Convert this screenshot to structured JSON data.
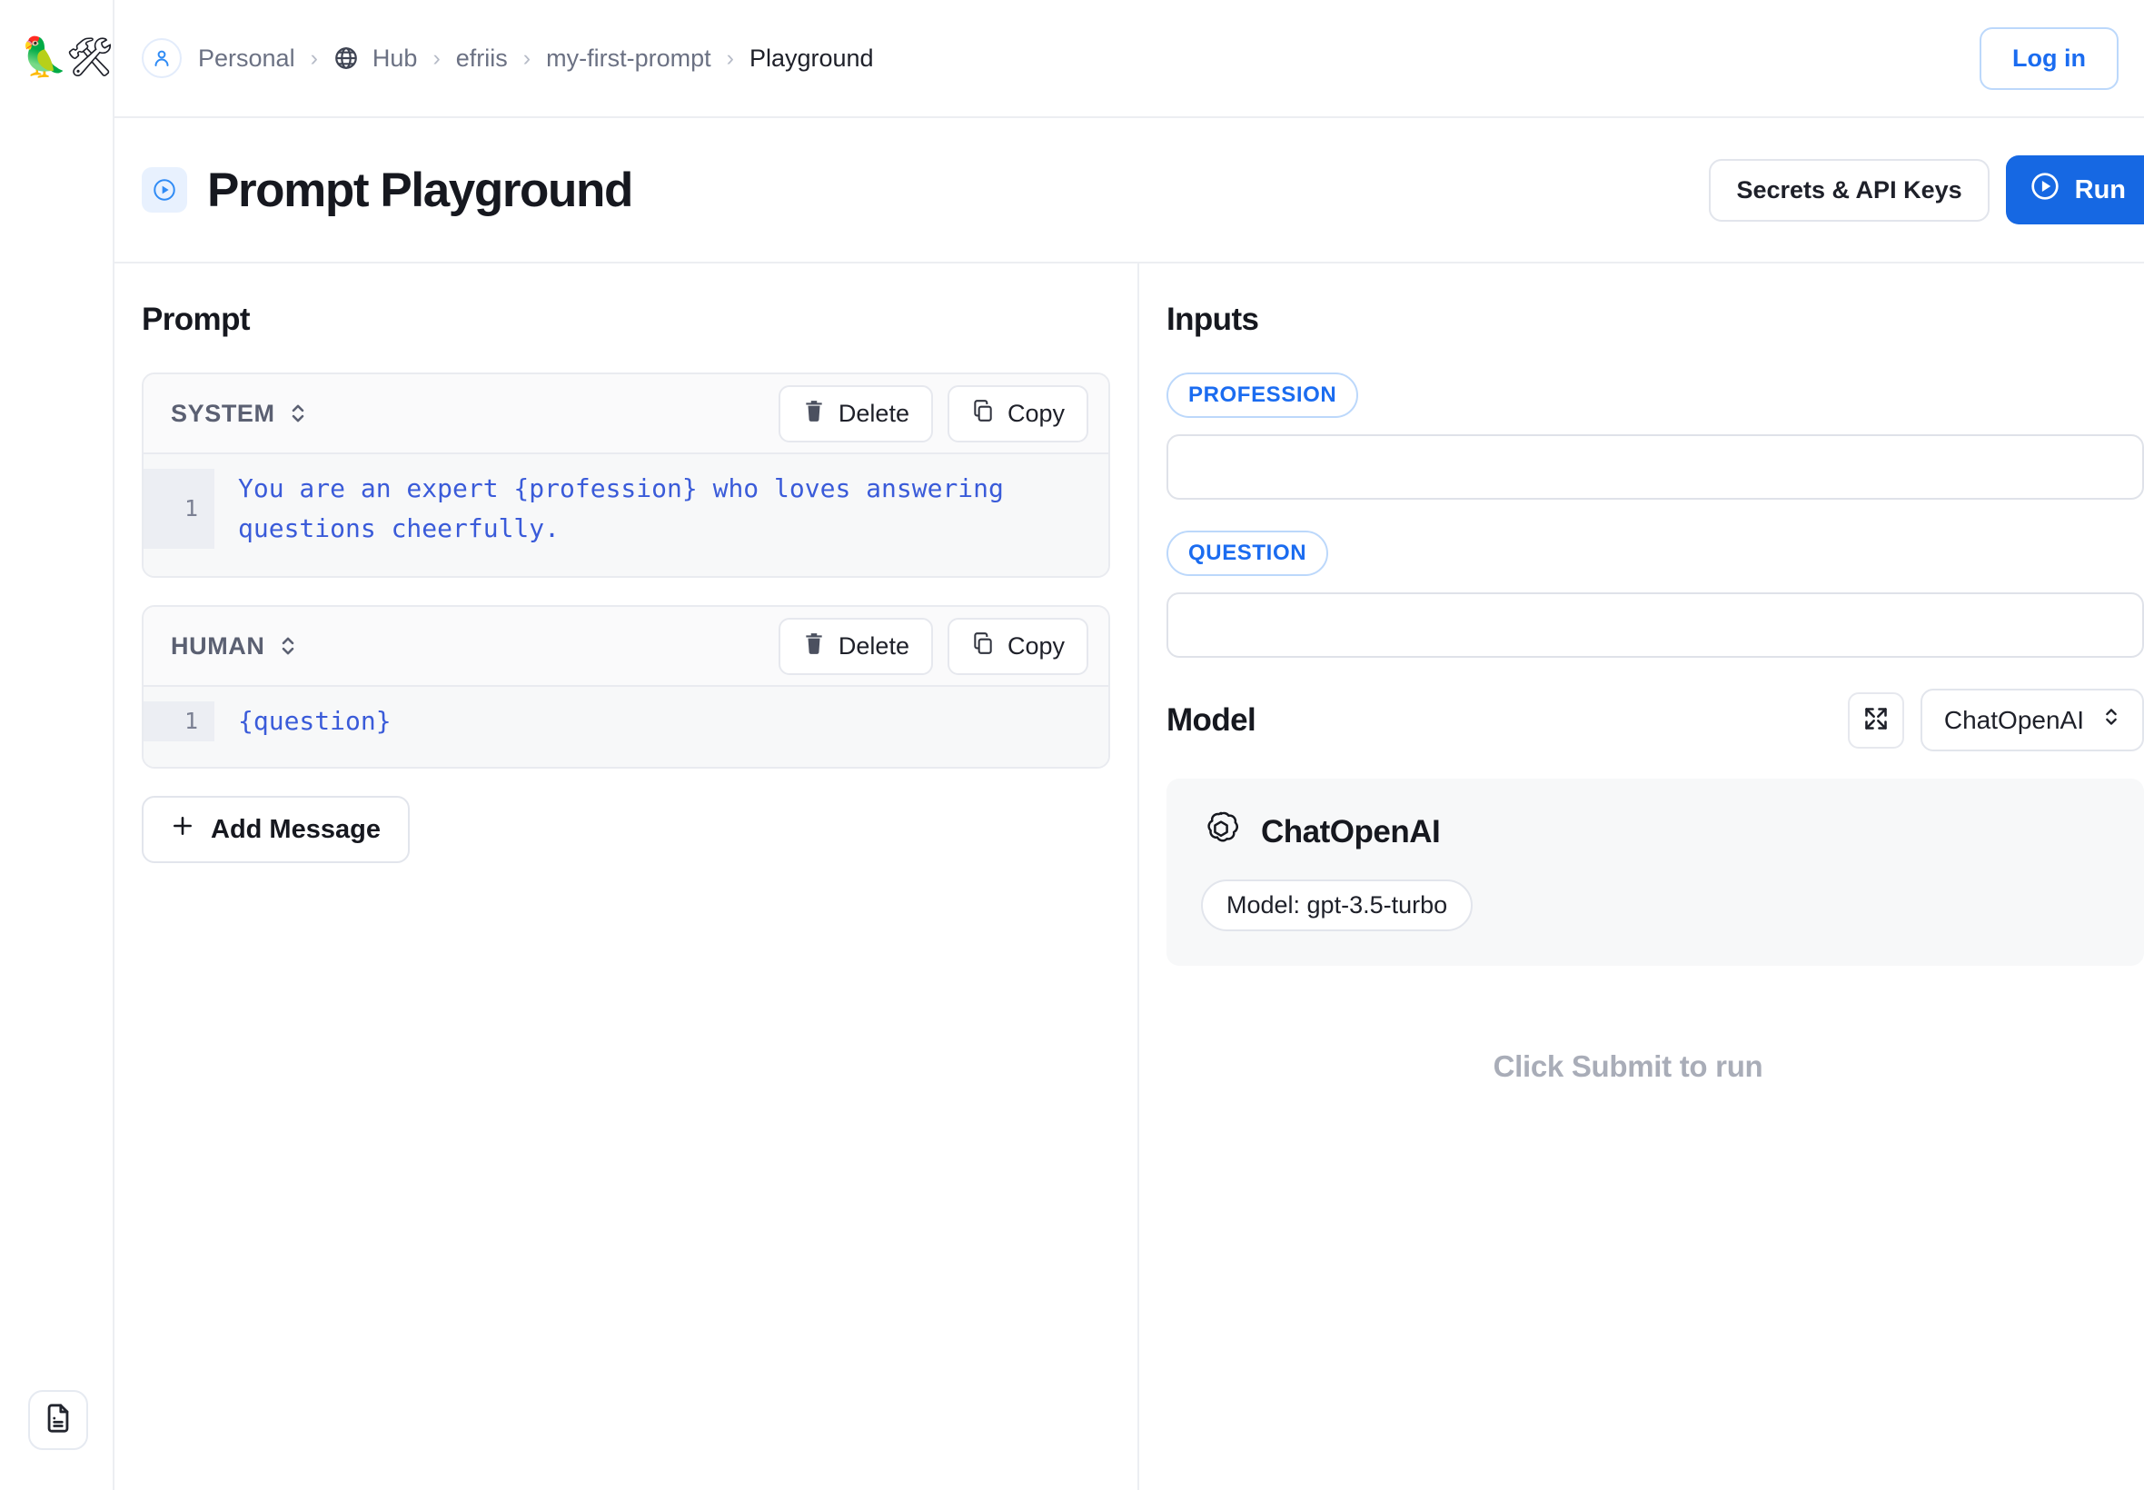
{
  "rail": {
    "logo": "🦜🛠",
    "logo_name": "langchain-logo",
    "bottom_button_icon": "document-icon"
  },
  "breadcrumb": {
    "avatar_icon": "user-icon",
    "globe_icon": "globe-icon",
    "separator": "›",
    "items": [
      {
        "label": "Personal",
        "current": false
      },
      {
        "label": "Hub",
        "current": false
      },
      {
        "label": "efriis",
        "current": false
      },
      {
        "label": "my-first-prompt",
        "current": false
      },
      {
        "label": "Playground",
        "current": true
      }
    ]
  },
  "topbar": {
    "login_label": "Log in"
  },
  "header": {
    "title": "Prompt Playground",
    "title_icon": "play-circle-icon",
    "secrets_label": "Secrets & API Keys",
    "run_label": "Run",
    "run_icon": "play-circle-icon"
  },
  "prompt": {
    "heading": "Prompt",
    "messages": [
      {
        "role": "SYSTEM",
        "stepper_icon": "chevron-up-down-icon",
        "delete_label": "Delete",
        "delete_icon": "trash-icon",
        "copy_label": "Copy",
        "copy_icon": "copy-icon",
        "line_number": "1",
        "content": "You are an expert {profession} who loves answering questions cheerfully."
      },
      {
        "role": "HUMAN",
        "stepper_icon": "chevron-up-down-icon",
        "delete_label": "Delete",
        "delete_icon": "trash-icon",
        "copy_label": "Copy",
        "copy_icon": "copy-icon",
        "line_number": "1",
        "content": "{question}"
      }
    ],
    "add_message_label": "Add Message",
    "add_message_icon": "plus-icon"
  },
  "inputs": {
    "heading": "Inputs",
    "fields": [
      {
        "badge": "PROFESSION",
        "value": "",
        "placeholder": ""
      },
      {
        "badge": "QUESTION",
        "value": "",
        "placeholder": ""
      }
    ]
  },
  "model": {
    "heading": "Model",
    "expand_icon": "expand-icon",
    "selected": "ChatOpenAI",
    "select_icon": "chevron-up-down-icon",
    "card": {
      "provider_icon": "openai-logo-icon",
      "name": "ChatOpenAI",
      "chip": "Model: gpt-3.5-turbo"
    }
  },
  "output": {
    "hint": "Click Submit to run"
  },
  "colors": {
    "accent_blue": "#1668e3",
    "link_blue": "#1b6cf0",
    "code_blue": "#3a5bd9",
    "muted": "#6b7183",
    "hint_gray": "#a9adb8"
  }
}
